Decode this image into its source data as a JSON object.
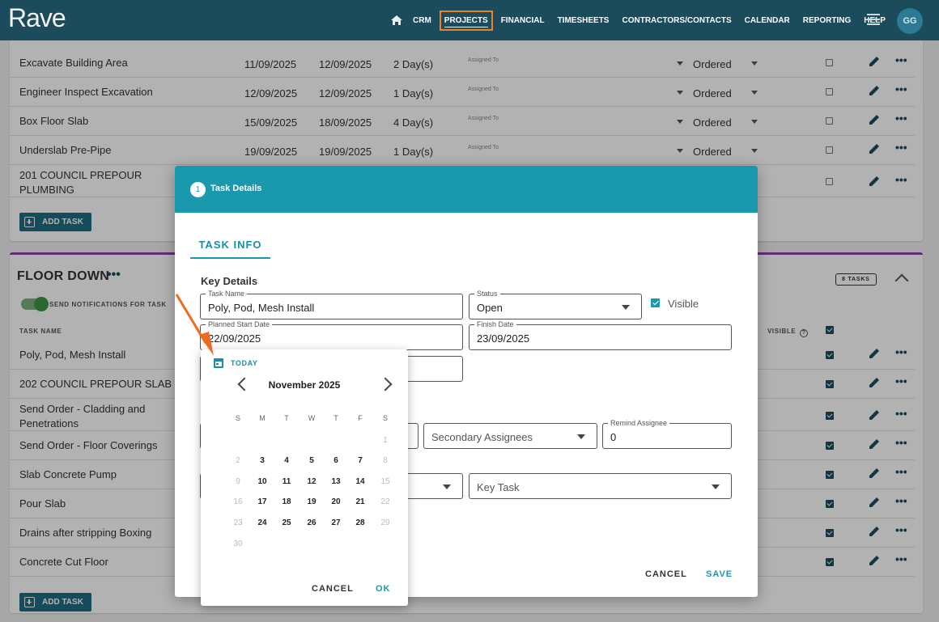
{
  "app": {
    "logo": "Rave",
    "avatar": "GG"
  },
  "nav": {
    "items": [
      "CRM",
      "PROJECTS",
      "FINANCIAL",
      "TIMESHEETS",
      "CONTRACTORS/CONTACTS",
      "CALENDAR",
      "REPORTING",
      "HELP"
    ],
    "active": "PROJECTS"
  },
  "section1": {
    "rows": [
      {
        "name": "Excavate Building Area",
        "start": "11/09/2025",
        "finish": "12/09/2025",
        "duration": "2 Day(s)",
        "assigned": "Assigned To",
        "status": "Ordered"
      },
      {
        "name": "Engineer Inspect Excavation",
        "start": "12/09/2025",
        "finish": "12/09/2025",
        "duration": "1 Day(s)",
        "assigned": "Assigned To",
        "status": "Ordered"
      },
      {
        "name": "Box Floor Slab",
        "start": "15/09/2025",
        "finish": "18/09/2025",
        "duration": "4 Day(s)",
        "assigned": "Assigned To",
        "status": "Ordered"
      },
      {
        "name": "Underslab Pre-Pipe",
        "start": "19/09/2025",
        "finish": "19/09/2025",
        "duration": "1 Day(s)",
        "assigned": "Assigned To",
        "status": "Ordered"
      },
      {
        "name": "201 COUNCIL PREPOUR PLUMBING"
      }
    ],
    "add_task": "ADD TASK"
  },
  "section2": {
    "title": "FLOOR DOWN",
    "tasks_badge": "8 TASKS",
    "notify_label": "SEND NOTIFICATIONS FOR TASK",
    "col_task_name": "TASK NAME",
    "col_visible": "VISIBLE",
    "rows": [
      {
        "name": "Poly, Pod, Mesh Install"
      },
      {
        "name": "202 COUNCIL PREPOUR SLAB"
      },
      {
        "name": "Send Order - Cladding and Penetrations"
      },
      {
        "name": "Send Order - Floor Coverings"
      },
      {
        "name": "Slab Concrete Pump"
      },
      {
        "name": "Pour Slab"
      },
      {
        "name": "Drains after stripping Boxing"
      },
      {
        "name": "Concrete Cut Floor"
      }
    ],
    "add_task": "ADD TASK"
  },
  "modal": {
    "step": "1",
    "title": "Task Details",
    "tab": "TASK INFO",
    "key_details": "Key Details",
    "task_name_label": "Task Name",
    "task_name": "Poly, Pod, Mesh Install",
    "status_label": "Status",
    "status": "Open",
    "visible_label": "Visible",
    "planned_start_label": "Planned Start Date",
    "planned_start": "22/09/2025",
    "finish_label": "Finish Date",
    "finish": "23/09/2025",
    "secondary_assignees": "Secondary Assignees",
    "remind_label": "Remind Assignee",
    "remind": "0",
    "key_task": "Key Task",
    "cancel": "CANCEL",
    "save": "SAVE"
  },
  "picker": {
    "today": "TODAY",
    "month": "November 2025",
    "dow": [
      "S",
      "M",
      "T",
      "W",
      "T",
      "F",
      "S"
    ],
    "weeks": [
      [
        "",
        "",
        "",
        "",
        "",
        "",
        "1"
      ],
      [
        "2",
        "3",
        "4",
        "5",
        "6",
        "7",
        "8"
      ],
      [
        "9",
        "10",
        "11",
        "12",
        "13",
        "14",
        "15"
      ],
      [
        "16",
        "17",
        "18",
        "19",
        "20",
        "21",
        "22"
      ],
      [
        "23",
        "24",
        "25",
        "26",
        "27",
        "28",
        "29"
      ],
      [
        "30",
        "",
        "",
        "",
        "",
        "",
        ""
      ]
    ],
    "cancel": "CANCEL",
    "ok": "OK"
  },
  "colors": {
    "nav_bg": "#1c4b5c",
    "accent": "#1a99ae",
    "highlight": "#f07f25",
    "section_border": "#8e3fb0"
  }
}
